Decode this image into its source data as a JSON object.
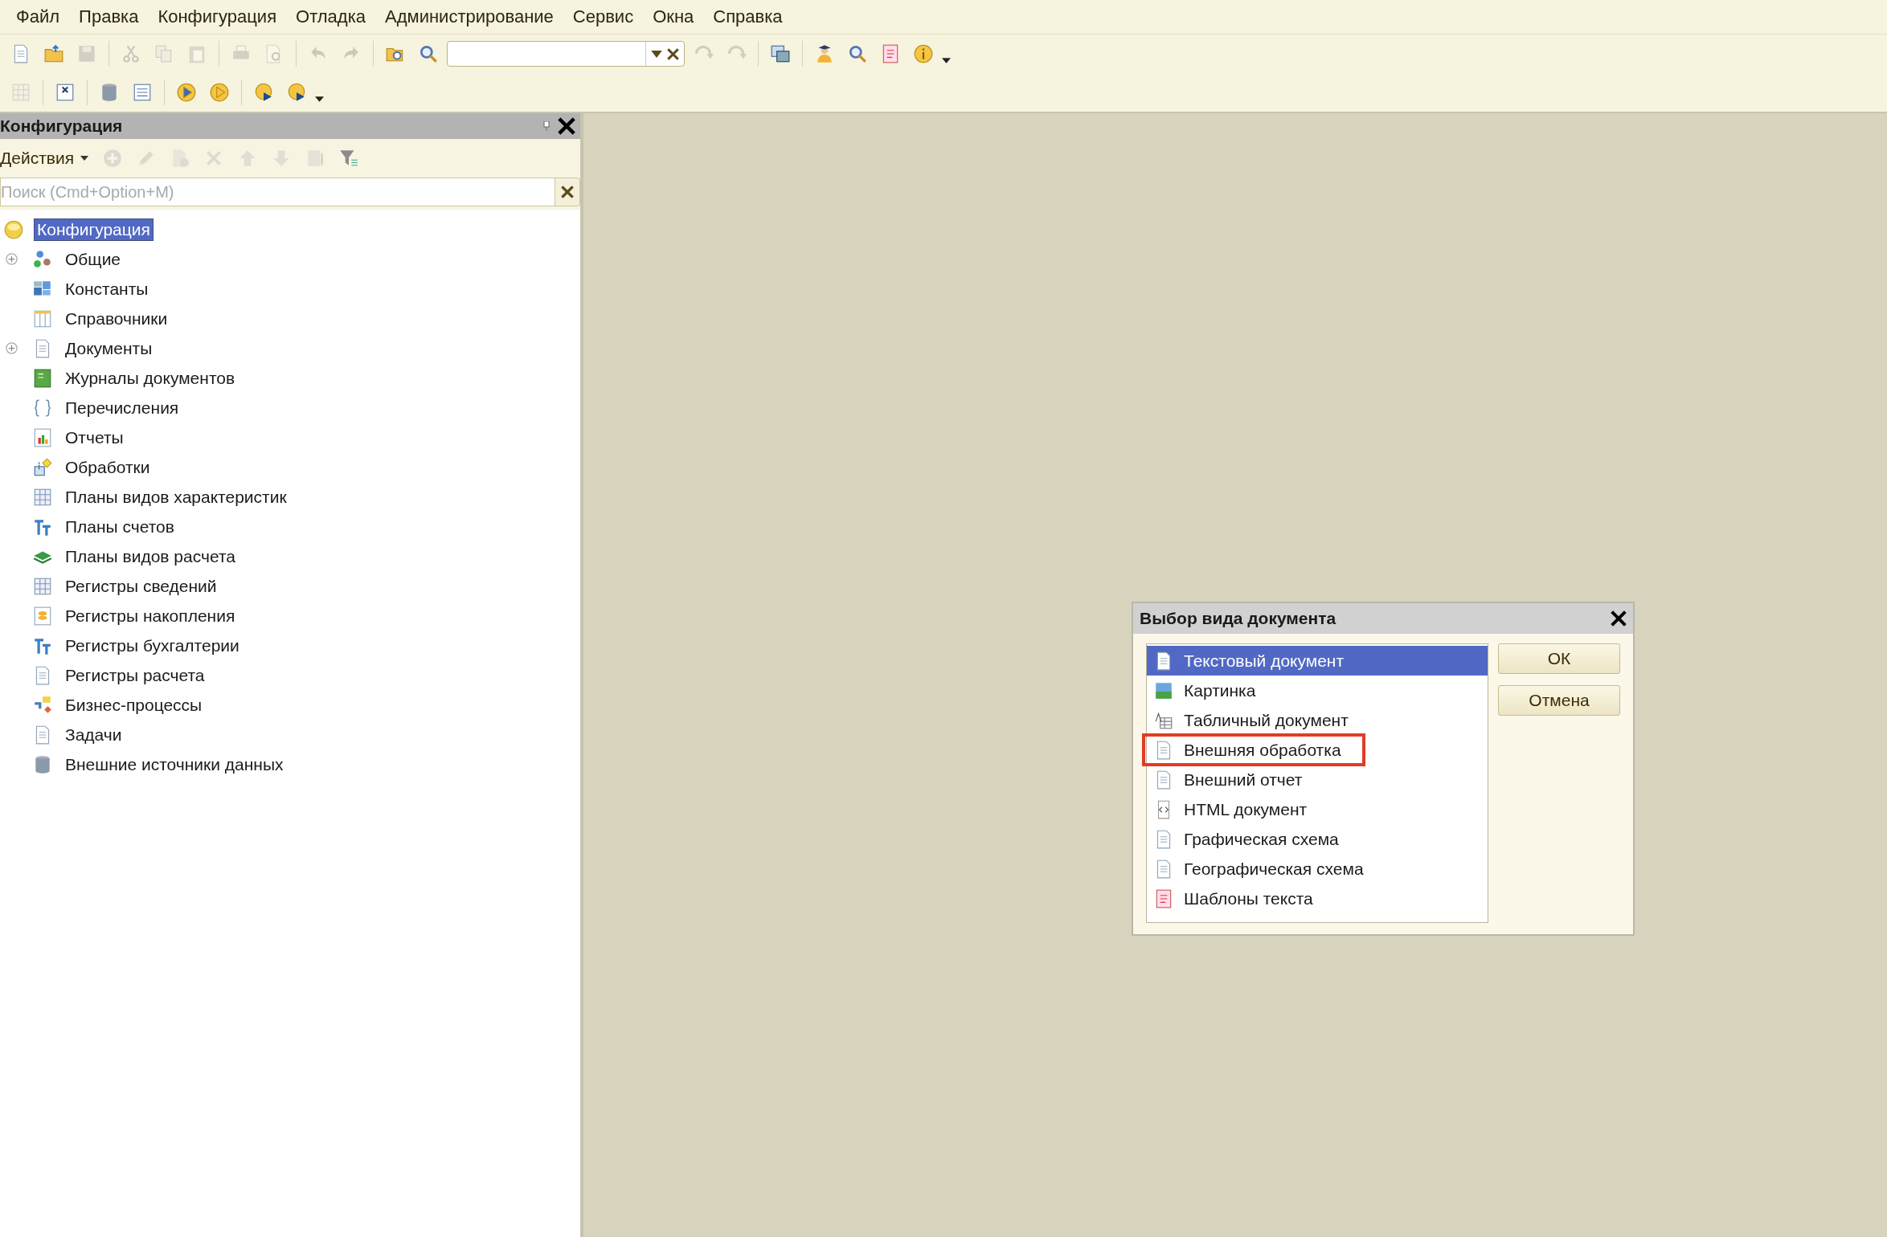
{
  "menu": [
    "Файл",
    "Правка",
    "Конфигурация",
    "Отладка",
    "Администрирование",
    "Сервис",
    "Окна",
    "Справка"
  ],
  "toolbar_1": [
    {
      "kind": "button",
      "disabled": false
    },
    {
      "kind": "button",
      "disabled": false
    },
    {
      "kind": "button",
      "disabled": true
    },
    {
      "kind": "separator"
    },
    {
      "kind": "button",
      "disabled": true
    },
    {
      "kind": "button",
      "disabled": true
    },
    {
      "kind": "button",
      "disabled": true
    },
    {
      "kind": "separator"
    },
    {
      "kind": "button",
      "disabled": true
    },
    {
      "kind": "button",
      "disabled": true
    },
    {
      "kind": "separator"
    },
    {
      "kind": "button",
      "disabled": true
    },
    {
      "kind": "button",
      "disabled": true
    },
    {
      "kind": "separator"
    },
    {
      "kind": "button",
      "disabled": false
    },
    {
      "kind": "button",
      "disabled": false
    },
    {
      "kind": "search_box"
    },
    {
      "kind": "button",
      "disabled": true
    },
    {
      "kind": "button",
      "disabled": true
    },
    {
      "kind": "separator"
    },
    {
      "kind": "button",
      "disabled": false
    },
    {
      "kind": "separator"
    },
    {
      "kind": "button",
      "disabled": false
    },
    {
      "kind": "button",
      "disabled": false
    },
    {
      "kind": "button",
      "disabled": false
    },
    {
      "kind": "button",
      "disabled": false
    },
    {
      "kind": "more"
    }
  ],
  "toolbar_2": [
    {
      "kind": "button",
      "disabled": true
    },
    {
      "kind": "separator"
    },
    {
      "kind": "button",
      "disabled": false
    },
    {
      "kind": "separator"
    },
    {
      "kind": "button",
      "disabled": false
    },
    {
      "kind": "button",
      "disabled": false
    },
    {
      "kind": "separator"
    },
    {
      "kind": "button",
      "disabled": false
    },
    {
      "kind": "button",
      "disabled": false
    },
    {
      "kind": "separator"
    },
    {
      "kind": "button",
      "disabled": false
    },
    {
      "kind": "button",
      "disabled": false
    },
    {
      "kind": "more"
    }
  ],
  "panel": {
    "title": "Конфигурация",
    "actions_label": "Действия",
    "actions": [
      {
        "disabled": true
      },
      {
        "disabled": true
      },
      {
        "disabled": true
      },
      {
        "disabled": true
      },
      {
        "disabled": true
      },
      {
        "disabled": true
      },
      {
        "disabled": true
      },
      {
        "disabled": false
      }
    ],
    "search": {
      "placeholder": "Поиск (Cmd+Option+M)"
    },
    "tree": {
      "label": "Конфигурация",
      "selected": true,
      "children": [
        {
          "label": "Общие",
          "selected": false,
          "expander": true
        },
        {
          "label": "Константы",
          "selected": false,
          "expander": false
        },
        {
          "label": "Справочники",
          "selected": false,
          "expander": false
        },
        {
          "label": "Документы",
          "selected": false,
          "expander": true
        },
        {
          "label": "Журналы документов",
          "selected": false,
          "expander": false
        },
        {
          "label": "Перечисления",
          "selected": false,
          "expander": false
        },
        {
          "label": "Отчеты",
          "selected": false,
          "expander": false
        },
        {
          "label": "Обработки",
          "selected": false,
          "expander": false
        },
        {
          "label": "Планы видов характеристик",
          "selected": false,
          "expander": false
        },
        {
          "label": "Планы счетов",
          "selected": false,
          "expander": false
        },
        {
          "label": "Планы видов расчета",
          "selected": false,
          "expander": false
        },
        {
          "label": "Регистры сведений",
          "selected": false,
          "expander": false
        },
        {
          "label": "Регистры накопления",
          "selected": false,
          "expander": false
        },
        {
          "label": "Регистры бухгалтерии",
          "selected": false,
          "expander": false
        },
        {
          "label": "Регистры расчета",
          "selected": false,
          "expander": false
        },
        {
          "label": "Бизнес-процессы",
          "selected": false,
          "expander": false
        },
        {
          "label": "Задачи",
          "selected": false,
          "expander": false
        },
        {
          "label": "Внешние источники данных",
          "selected": false,
          "expander": false
        }
      ]
    }
  },
  "dialog": {
    "title": "Выбор вида документа",
    "items": [
      {
        "label": "Текстовый документ",
        "selected": true,
        "highlighted": false
      },
      {
        "label": "Картинка",
        "selected": false,
        "highlighted": false
      },
      {
        "label": "Табличный документ",
        "selected": false,
        "highlighted": false
      },
      {
        "label": "Внешняя обработка",
        "selected": false,
        "highlighted": true
      },
      {
        "label": "Внешний отчет",
        "selected": false,
        "highlighted": false
      },
      {
        "label": "HTML документ",
        "selected": false,
        "highlighted": false
      },
      {
        "label": "Графическая схема",
        "selected": false,
        "highlighted": false
      },
      {
        "label": "Географическая схема",
        "selected": false,
        "highlighted": false
      },
      {
        "label": "Шаблоны текста",
        "selected": false,
        "highlighted": false
      }
    ],
    "buttons": [
      "ОК",
      "Отмена"
    ]
  }
}
